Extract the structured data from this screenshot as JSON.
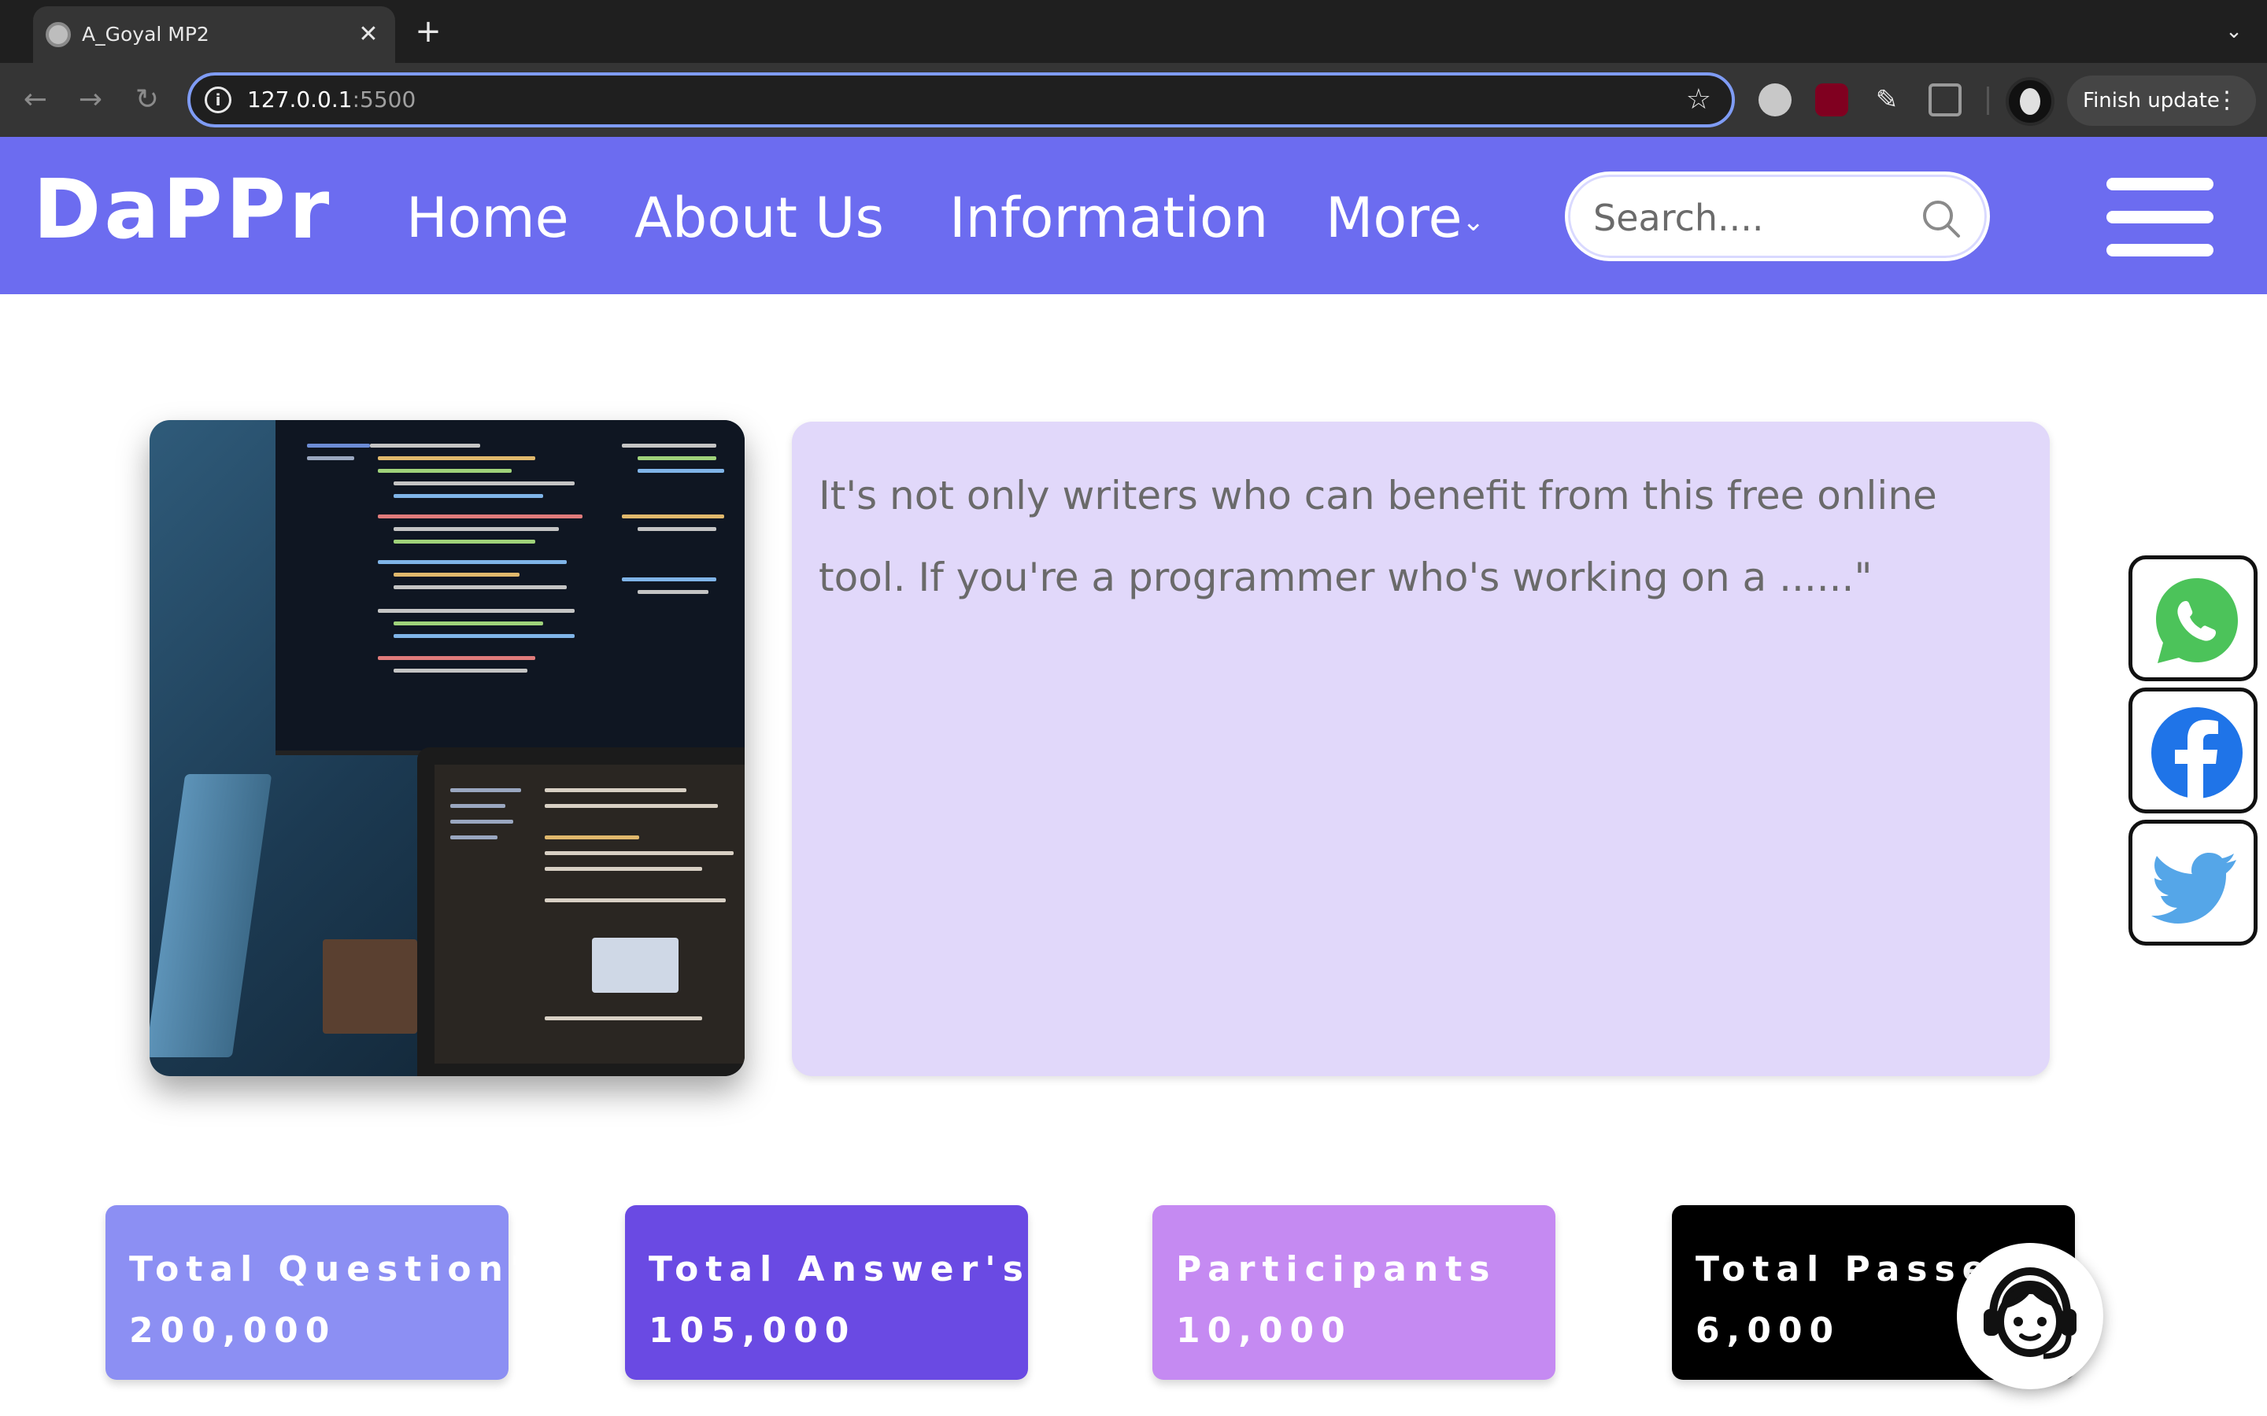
{
  "browser": {
    "tab_title": "A_Goyal MP2",
    "tab_close": "✕",
    "new_tab": "+",
    "tab_menu": "⌄",
    "url_host": "127.0.0.1",
    "url_port": ":5500",
    "finish_update": "Finish update",
    "menu_dots": "⋮",
    "accent": "#7f9cf5"
  },
  "site": {
    "logo": "DaPPr",
    "nav": {
      "home": "Home",
      "about": "About Us",
      "information": "Information",
      "more": "More",
      "more_chevron": "⌄"
    },
    "search_placeholder": "Search....",
    "header_color": "#6c6cf0"
  },
  "hero": {
    "quote": "It's not only writers who can benefit from this free online tool. If you're a programmer who's working on a ......\""
  },
  "social": [
    "whatsapp-icon",
    "facebook-icon",
    "twitter-icon"
  ],
  "stats": [
    {
      "label": "Total Question's",
      "value": "200,000",
      "color": "#8c8ff3"
    },
    {
      "label": "Total Answer's",
      "value": "105,000",
      "color": "#6a4ae3"
    },
    {
      "label": "Participants",
      "value": "10,000",
      "color": "#c58af2"
    },
    {
      "label": "Total Passed",
      "value": "6,000",
      "color": "#000000"
    }
  ]
}
